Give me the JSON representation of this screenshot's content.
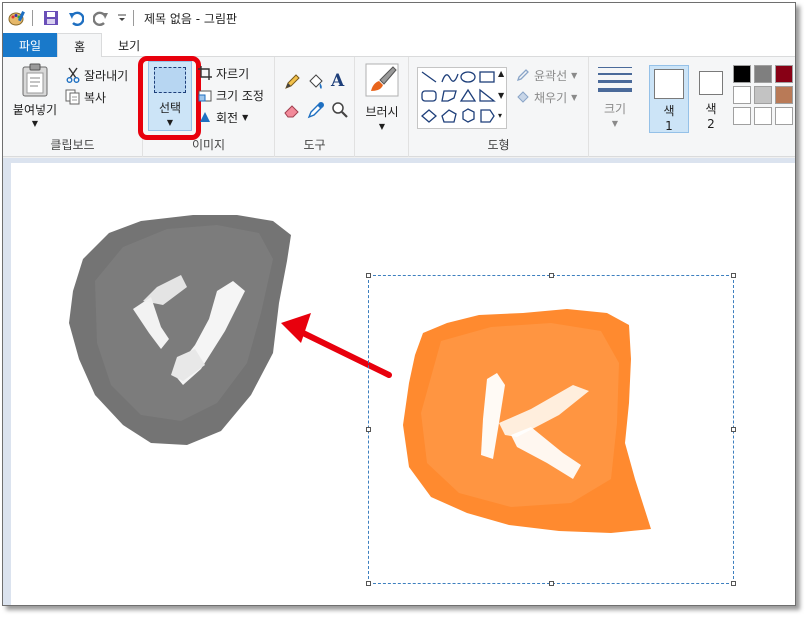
{
  "window": {
    "title": "제목 없음 - 그림판"
  },
  "tabs": [
    {
      "label": "파일"
    },
    {
      "label": "홈"
    },
    {
      "label": "보기"
    }
  ],
  "clipboard": {
    "paste_label": "붙여넣기",
    "cut_label": "잘라내기",
    "copy_label": "복사",
    "group_label": "클립보드"
  },
  "image": {
    "select_label": "선택",
    "crop_label": "자르기",
    "resize_label": "크기 조정",
    "rotate_label": "회전",
    "group_label": "이미지"
  },
  "tools": {
    "group_label": "도구"
  },
  "brush": {
    "label": "브러시"
  },
  "shapes": {
    "outline_label": "윤곽선",
    "fill_label": "채우기",
    "group_label": "도형"
  },
  "size": {
    "label": "크기"
  },
  "colors": {
    "color1_label": "색",
    "color1_number": "1",
    "color2_label": "색",
    "color2_number": "2",
    "palette": [
      "#000000",
      "#7f7f7f",
      "#880015",
      "#ffffff",
      "#c3c3c3",
      "#b97a57",
      "#ffffff",
      "#ffffff",
      "#ffffff"
    ]
  },
  "canvas_art": {
    "gray_letter": "y",
    "orange_letter": "k",
    "gray_color": "#6d6d6d",
    "orange_color": "#ff8a2f",
    "arrow_color": "#e8000d"
  }
}
